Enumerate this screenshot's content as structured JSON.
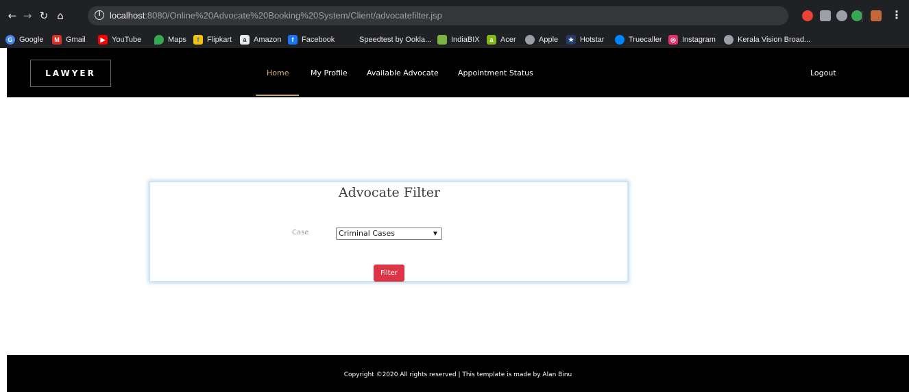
{
  "browser": {
    "url_host": "localhost",
    "url_rest": ":8080/Online%20Advocate%20Booking%20System/Client/advocatefilter.jsp",
    "icons": [
      "back-icon",
      "forward-icon",
      "reload-icon",
      "home-icon",
      "info-icon",
      "star-icon",
      "menu-dots-icon"
    ],
    "bookmarks": [
      {
        "label": "Google",
        "icon": "google-icon",
        "color": "#4285f4"
      },
      {
        "label": "Gmail",
        "icon": "gmail-icon",
        "color": "#d93025"
      },
      {
        "label": "YouTube",
        "icon": "youtube-icon",
        "color": "#ff0000"
      },
      {
        "label": "Maps",
        "icon": "maps-icon",
        "color": "#34a853"
      },
      {
        "label": "Flipkart",
        "icon": "flipkart-icon",
        "color": "#f4c20d"
      },
      {
        "label": "Amazon",
        "icon": "amazon-icon",
        "color": "#e8eaed"
      },
      {
        "label": "Facebook",
        "icon": "facebook-icon",
        "color": "#1877f2"
      },
      {
        "label": "Speedtest by Ookla...",
        "icon": "",
        "color": ""
      },
      {
        "label": "IndiaBIX",
        "icon": "indiabix-icon",
        "color": "#7cb342"
      },
      {
        "label": "Acer",
        "icon": "acer-icon",
        "color": "#83b81a"
      },
      {
        "label": "Apple",
        "icon": "apple-icon",
        "color": "#9aa0a6"
      },
      {
        "label": "Hotstar",
        "icon": "hotstar-icon",
        "color": "#1f3c6b"
      },
      {
        "label": "Truecaller",
        "icon": "truecaller-icon",
        "color": "#0087ff"
      },
      {
        "label": "Instagram",
        "icon": "instagram-icon",
        "color": "#e1306c"
      },
      {
        "label": "Kerala Vision Broad...",
        "icon": "globe-icon",
        "color": "#9aa0a6"
      }
    ]
  },
  "header": {
    "logo": "LAWYER",
    "nav": [
      "Home",
      "My Profile",
      "Available Advocate",
      "Appointment Status"
    ],
    "active": "Home",
    "logout": "Logout"
  },
  "filter": {
    "title": "Advocate Filter",
    "case_label": "Case",
    "case_selected": "Criminal Cases",
    "button": "Filter"
  },
  "footer": {
    "copyright": "Copyright ©2020 All rights reserved | This template is made by Alan Binu"
  },
  "colors": {
    "accent": "#d4b57f",
    "button": "#dc3545",
    "header_bg": "#000000"
  }
}
